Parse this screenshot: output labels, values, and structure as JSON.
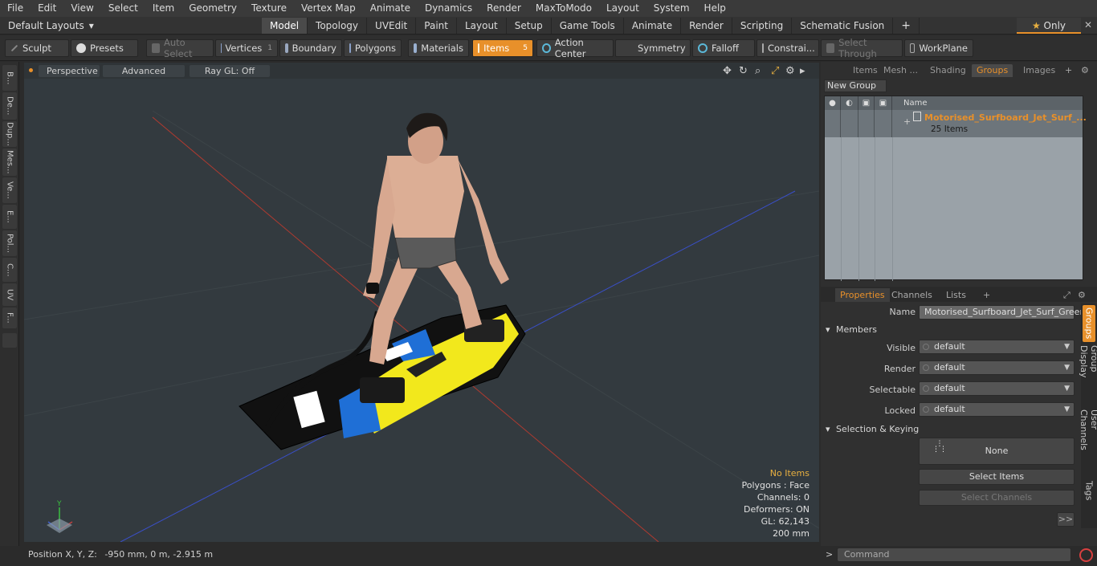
{
  "menu": [
    "File",
    "Edit",
    "View",
    "Select",
    "Item",
    "Geometry",
    "Texture",
    "Vertex Map",
    "Animate",
    "Dynamics",
    "Render",
    "MaxToModo",
    "Layout",
    "System",
    "Help"
  ],
  "layout_dropdown": "Default Layouts",
  "layout_tabs": [
    "Model",
    "Topology",
    "UVEdit",
    "Paint",
    "Layout",
    "Setup",
    "Game Tools",
    "Animate",
    "Render",
    "Scripting",
    "Schematic Fusion"
  ],
  "active_layout_tab": "Model",
  "only_label": "Only",
  "toolbar": {
    "sculpt": "Sculpt",
    "presets": "Presets",
    "auto_select": "Auto Select",
    "vertices": "Vertices",
    "vertices_count": "1",
    "boundary": "Boundary",
    "polygons": "Polygons",
    "materials": "Materials",
    "items": "Items",
    "items_count": "5",
    "action_center": "Action Center",
    "symmetry": "Symmetry",
    "falloff": "Falloff",
    "constraints": "Constrai...",
    "select_through": "Select Through",
    "workplane": "WorkPlane"
  },
  "left_tabs": [
    "B...",
    "De...",
    "Dup...",
    "Mes...",
    "Ve...",
    "E...",
    "Pol...",
    "C...",
    "UV",
    "F..."
  ],
  "viewport": {
    "perspective": "Perspective",
    "advanced": "Advanced",
    "raygl": "Ray GL: Off",
    "info": {
      "no_items": "No Items",
      "polygons": "Polygons : Face",
      "channels": "Channels: 0",
      "deformers": "Deformers: ON",
      "gl": "GL: 62,143",
      "scale": "200 mm"
    }
  },
  "status": {
    "position_label": "Position X, Y, Z:",
    "position_value": "-950 mm, 0 m, -2.915 m"
  },
  "right_top": {
    "tabs": [
      "Items",
      "Mesh ...",
      "Shading",
      "Groups",
      "Images"
    ],
    "active_tab": "Groups",
    "new_group": "New Group",
    "column_name": "Name",
    "group_name": "Motorised_Surfboard_Jet_Surf_...",
    "group_count": "25 Items"
  },
  "properties": {
    "tabs": [
      "Properties",
      "Channels",
      "Lists"
    ],
    "active_tab": "Properties",
    "name_label": "Name",
    "name_value": "Motorised_Surfboard_Jet_Surf_Greer",
    "members_section": "Members",
    "fields": [
      {
        "label": "Visible",
        "value": "default"
      },
      {
        "label": "Render",
        "value": "default"
      },
      {
        "label": "Selectable",
        "value": "default"
      },
      {
        "label": "Locked",
        "value": "default"
      }
    ],
    "selection_section": "Selection & Keying",
    "none_button": "None",
    "select_items": "Select Items",
    "select_channels": "Select Channels",
    "more": ">>",
    "vertical_tabs": [
      "Groups",
      "Group Display",
      "User Channels",
      "Tags"
    ]
  },
  "command": {
    "prompt": ">",
    "placeholder": "Command"
  },
  "colors": {
    "accent": "#e8902a",
    "x_axis": "#c0392b",
    "z_axis": "#3a4fc7"
  }
}
